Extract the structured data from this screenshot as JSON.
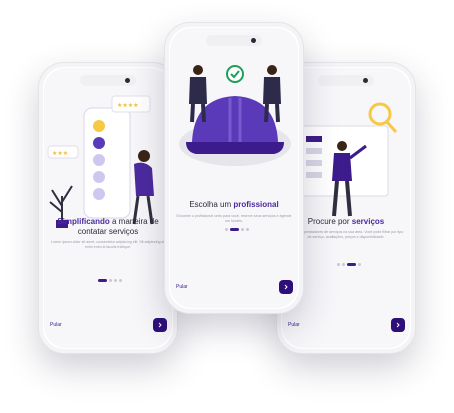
{
  "colors": {
    "accent": "#3c1b8c",
    "button": "#2e0f7a",
    "highlight": "#4b2a9e",
    "text": "#2b2b3a",
    "muted": "#9a9aa8"
  },
  "screens": {
    "left": {
      "title_highlight": "Simplificando",
      "title_rest": " a maneira de contatar serviços",
      "description": "Lorem ipsum dolor sit amet, consectetur adipiscing elit. Sit adipiscing sit enim enim id iaculis tristique.",
      "skip_label": "Pular",
      "next_icon": "chevron-right-icon",
      "page_index": 1,
      "page_count": 4
    },
    "center": {
      "title_plain": "Escolha um ",
      "title_highlight": "profissional",
      "description": "Encontre o profissional certo para você, reserve seus serviços e agende um horário.",
      "skip_label": "Pular",
      "next_icon": "chevron-right-icon",
      "page_index": 2,
      "page_count": 4
    },
    "right": {
      "title_plain": "Procure por ",
      "title_highlight": "serviços",
      "description": "Encontre prestadores de serviços na sua área. Você pode filtrar por tipo de serviço, avaliações, preços e disponibilidade.",
      "skip_label": "Pular",
      "next_icon": "chevron-right-icon",
      "page_index": 3,
      "page_count": 4
    }
  }
}
